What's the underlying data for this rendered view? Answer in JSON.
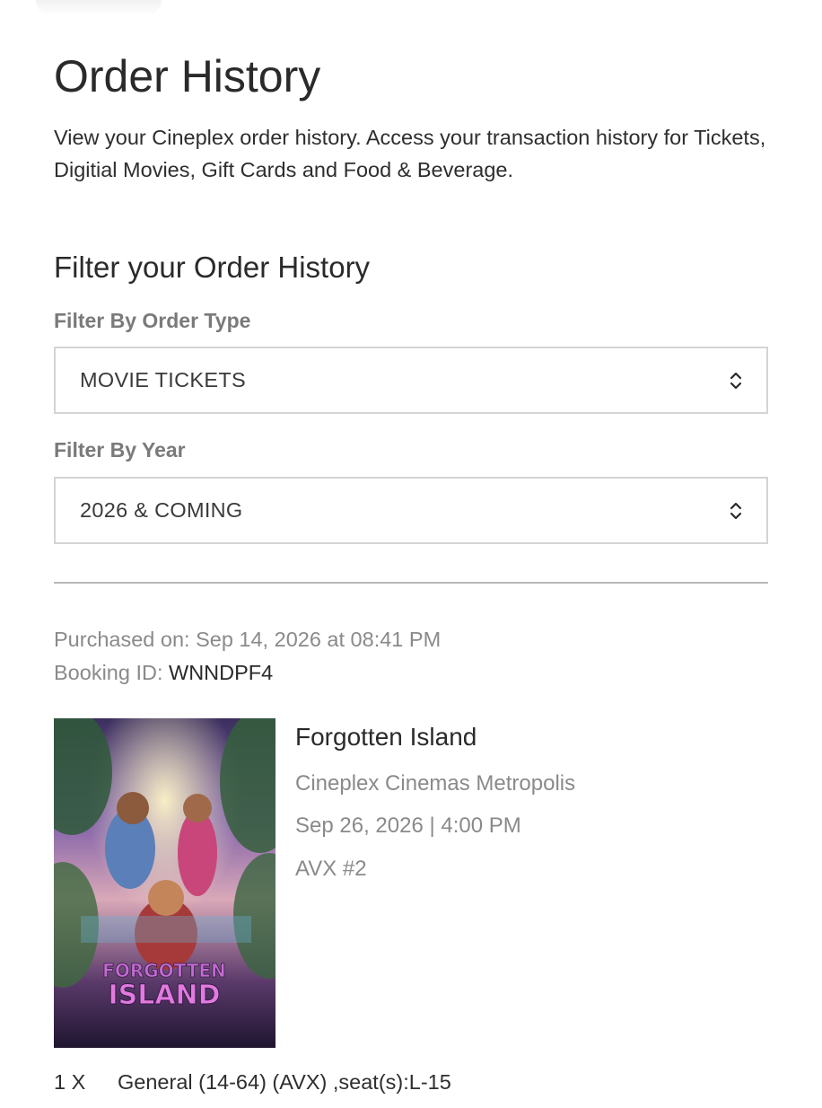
{
  "page": {
    "title": "Order History",
    "intro": "View your Cineplex order history. Access your transaction history for Tickets, Digitial Movies, Gift Cards and Food & Beverage."
  },
  "filters": {
    "heading": "Filter your Order History",
    "order_type": {
      "label": "Filter By Order Type",
      "selected": "MOVIE TICKETS"
    },
    "year": {
      "label": "Filter By Year",
      "selected": "2026 & COMING"
    }
  },
  "order": {
    "purchased_label": "Purchased on:",
    "purchased_value": "Sep 14, 2026 at 08:41 PM",
    "booking_label": "Booking ID:",
    "booking_value": "WNNDPF4",
    "movie": {
      "title": "Forgotten Island",
      "theatre": "Cineplex Cinemas Metropolis",
      "showtime": "Sep 26, 2026 | 4:00 PM",
      "auditorium": "AVX #2",
      "poster_icon": "movie-poster-image",
      "poster_title_line1": "FORGOTTEN",
      "poster_title_line2": "ISLAND"
    },
    "ticket": {
      "qty": "1 X",
      "description": "General (14-64) (AVX) ,seat(s):L-15"
    }
  }
}
